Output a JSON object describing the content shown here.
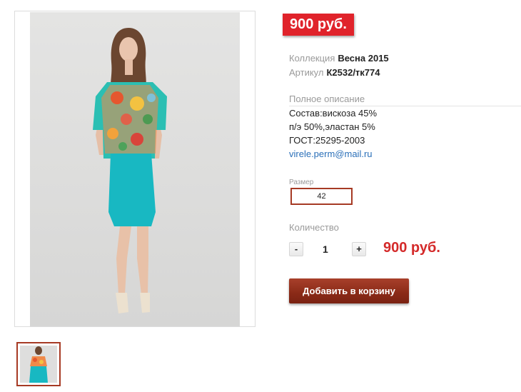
{
  "product": {
    "price_badge": "900 руб.",
    "collection_label": "Коллекция",
    "collection_value": "Весна 2015",
    "article_label": "Артикул",
    "article_value": "К2532/тк774",
    "description_header": "Полное описание",
    "description_lines": [
      "Состав:вискоза 45%",
      "п/э 50%,эластан 5%",
      "ГОСТ:25295-2003"
    ],
    "contact_email": "virele.perm@mail.ru"
  },
  "options": {
    "size_label": "Размер",
    "size_value": "42",
    "quantity_label": "Количество",
    "minus_label": "-",
    "quantity_value": "1",
    "plus_label": "+",
    "total_price": "900 руб."
  },
  "actions": {
    "add_to_cart": "Добавить в корзину"
  },
  "colors": {
    "price_badge_bg": "#e0232b",
    "accent_border": "#a63a24",
    "button_bg": "#8a2a17",
    "total_price": "#d42a2a",
    "link": "#2a6fb8"
  }
}
